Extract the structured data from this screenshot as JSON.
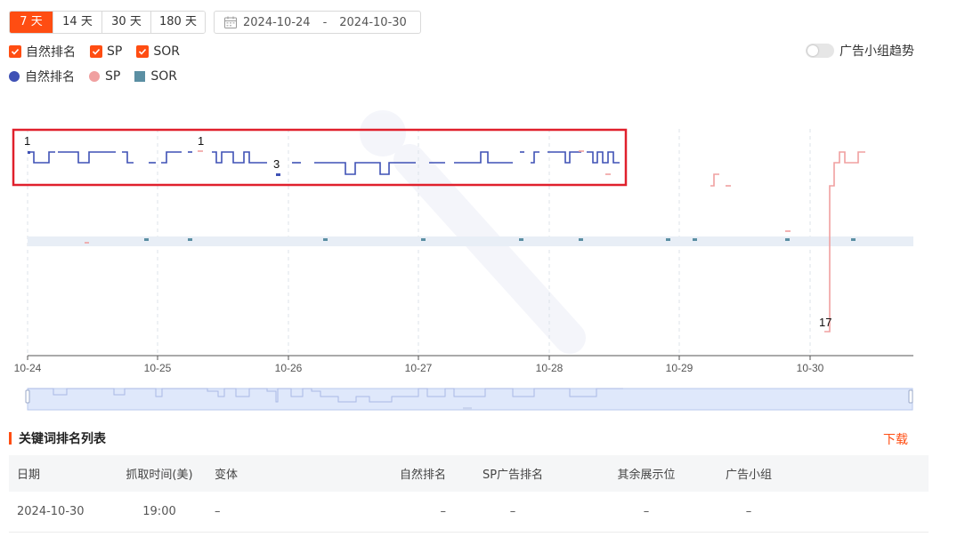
{
  "range_tabs": [
    {
      "label": "7 天",
      "active": true
    },
    {
      "label": "14 天",
      "active": false
    },
    {
      "label": "30 天",
      "active": false
    },
    {
      "label": "180 天",
      "active": false
    }
  ],
  "date_range": {
    "start": "2024-10-24",
    "separator": "-",
    "end": "2024-10-30"
  },
  "filters": [
    {
      "label": "自然排名",
      "checked": true
    },
    {
      "label": "SP",
      "checked": true
    },
    {
      "label": "SOR",
      "checked": true
    }
  ],
  "toggle": {
    "label": "广告小组趋势",
    "on": false
  },
  "colors": {
    "accent": "#ff4d12",
    "natural": "#3f51b5",
    "sp": "#f0a0a0",
    "sor": "#5b8fa3",
    "highlight_box": "#e0202c"
  },
  "chart_data": {
    "type": "line",
    "x_tick_labels": [
      "10-24",
      "10-25",
      "10-26",
      "10-27",
      "10-28",
      "10-29",
      "10-30"
    ],
    "y_axis": "rank, inverted (1 at top)",
    "grid": "vertical dashed lines at each day",
    "legend": [
      {
        "name": "自然排名",
        "marker": "circle"
      },
      {
        "name": "SP",
        "marker": "circle"
      },
      {
        "name": "SOR",
        "marker": "square"
      }
    ],
    "annotations": [
      "1",
      "1",
      "3",
      "17"
    ],
    "series": [
      {
        "name": "自然排名",
        "values_description": "rank mostly 1-2, briefly 3, between 10-24 and 10-28"
      },
      {
        "name": "SP",
        "values_description": "sparse points; rank 17 near 10-30 then rising to 1-2"
      },
      {
        "name": "SOR",
        "values_description": "sparse markers on baseline band"
      }
    ]
  },
  "section": {
    "title": "关键词排名列表",
    "download": "下载"
  },
  "table": {
    "headers": [
      "日期",
      "抓取时间(美)",
      "变体",
      "自然排名",
      "SP广告排名",
      "其余展示位",
      "广告小组"
    ],
    "rows": [
      [
        "2024-10-30",
        "19:00",
        "–",
        "–",
        "–",
        "–",
        "–"
      ]
    ]
  }
}
